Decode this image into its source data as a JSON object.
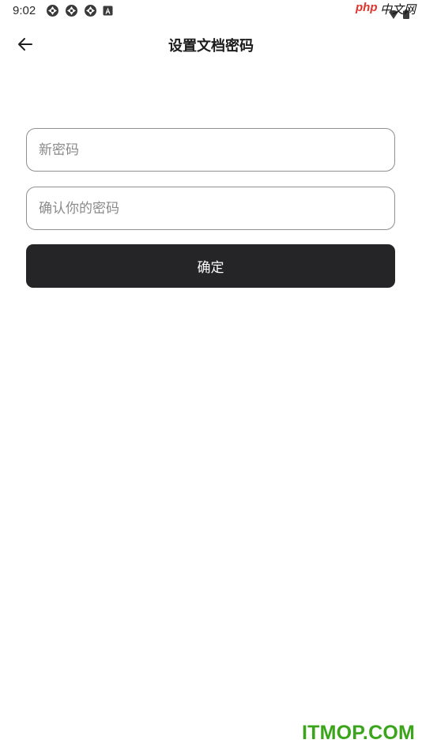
{
  "status_bar": {
    "time": "9:02",
    "icons": [
      "sync-icon",
      "sync-icon",
      "sync-icon",
      "font-app-icon"
    ],
    "right_icons": [
      "wifi-icon",
      "battery-icon"
    ]
  },
  "watermark_top": {
    "php": "php",
    "cn": "中文网"
  },
  "app_bar": {
    "back_icon": "arrow-left-icon",
    "title": "设置文档密码"
  },
  "form": {
    "new_password_placeholder": "新密码",
    "new_password_value": "",
    "confirm_password_placeholder": "确认你的密码",
    "confirm_password_value": "",
    "submit_label": "确定"
  },
  "watermark_bottom": "ITMOP.COM",
  "colors": {
    "button_bg": "#252527",
    "field_border": "#8e8e93",
    "watermark_green": "#3aa51a",
    "watermark_red": "#e0332c"
  }
}
